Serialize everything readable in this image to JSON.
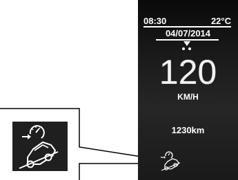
{
  "status": {
    "time": "08:30",
    "temperature": "22°C"
  },
  "date": "04/07/2014",
  "speed": {
    "value": "120",
    "unit": "KM/H"
  },
  "odometer": "1230km",
  "icons": {
    "indicator": "hill-descent-control-icon",
    "callout": "hill-descent-control-icon"
  }
}
